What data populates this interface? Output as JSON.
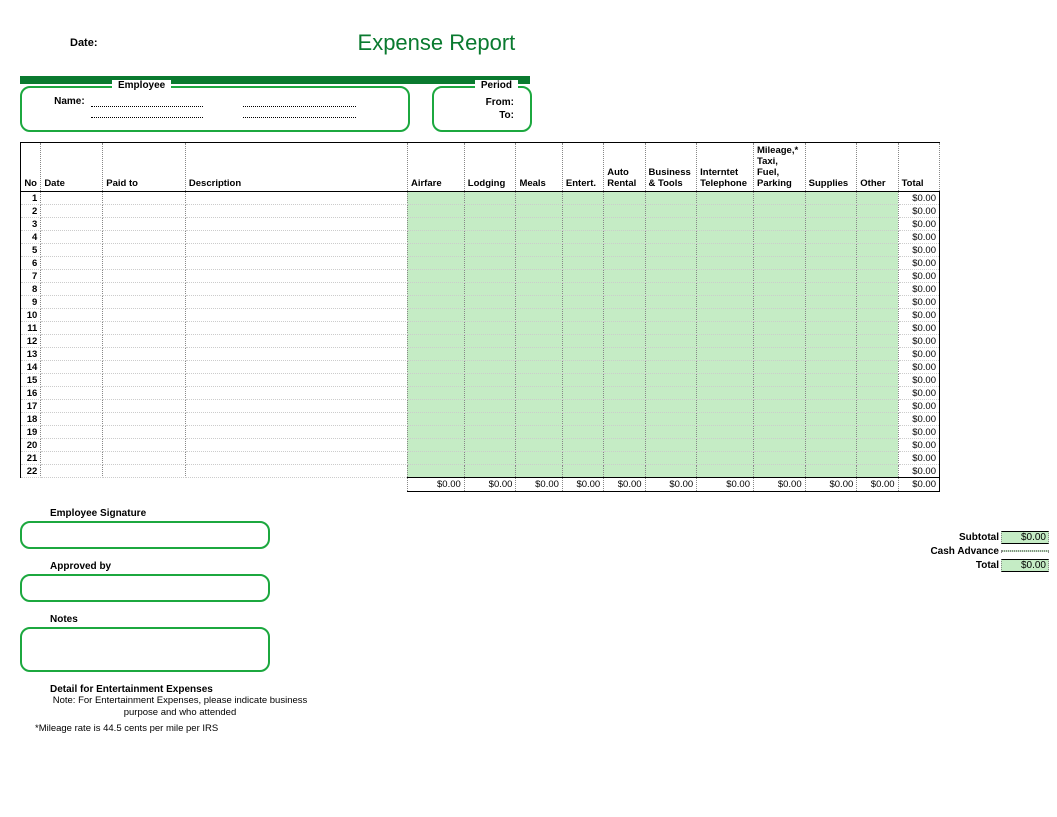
{
  "header": {
    "date_label": "Date:",
    "title": "Expense Report"
  },
  "employee": {
    "legend": "Employee",
    "name_label": "Name:"
  },
  "period": {
    "legend": "Period",
    "from_label": "From:",
    "to_label": "To:"
  },
  "columns": {
    "no": "No",
    "date": "Date",
    "paid_to": "Paid to",
    "description": "Description",
    "airfare": "Airfare",
    "lodging": "Lodging",
    "meals": "Meals",
    "entert": "Entert.",
    "auto_rental": "Auto Rental",
    "business_tools": "Business & Tools",
    "internet_telephone": "Interntet Telephone",
    "mileage": "Mileage,* Taxi, Fuel, Parking",
    "supplies": "Supplies",
    "other": "Other",
    "total": "Total"
  },
  "row_count": 22,
  "row_total": "$0.00",
  "column_totals": {
    "airfare": "$0.00",
    "lodging": "$0.00",
    "meals": "$0.00",
    "entert": "$0.00",
    "auto_rental": "$0.00",
    "business_tools": "$0.00",
    "internet_telephone": "$0.00",
    "mileage": "$0.00",
    "supplies": "$0.00",
    "other": "$0.00",
    "total": "$0.00"
  },
  "summary": {
    "subtotal_label": "Subtotal",
    "subtotal_value": "$0.00",
    "cash_advance_label": "Cash Advance",
    "cash_advance_value": "",
    "total_label": "Total",
    "total_value": "$0.00"
  },
  "signatures": {
    "employee_signature": "Employee Signature",
    "approved_by": "Approved by",
    "notes": "Notes"
  },
  "footer": {
    "detail_heading": "Detail for Entertainment Expenses",
    "detail_note": "Note: For Entertainment Expenses, please indicate business purpose and who attended",
    "mileage_note": "*Mileage rate is 44.5 cents per mile per IRS"
  }
}
